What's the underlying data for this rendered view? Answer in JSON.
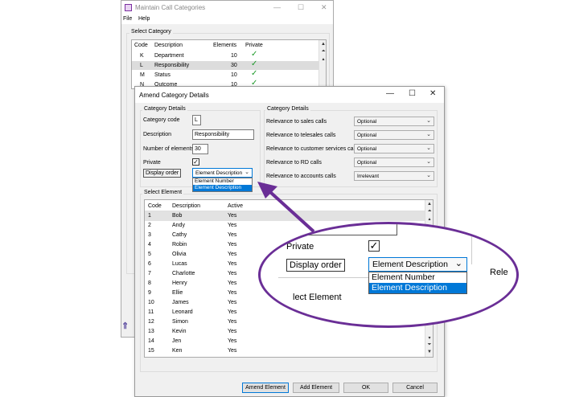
{
  "back_window": {
    "title": "Maintain Call Categories",
    "menu": [
      "File",
      "Help"
    ],
    "group_title": "Select Category",
    "columns": [
      "Code",
      "Description",
      "Elements",
      "Private"
    ],
    "rows": [
      {
        "code": "K",
        "description": "Department",
        "elements": "10",
        "private": "✓"
      },
      {
        "code": "L",
        "description": "Responsibility",
        "elements": "30",
        "private": "✓"
      },
      {
        "code": "M",
        "description": "Status",
        "elements": "10",
        "private": "✓"
      },
      {
        "code": "N",
        "description": "Outcome",
        "elements": "10",
        "private": "✓"
      }
    ],
    "selected_row": 1
  },
  "dialog": {
    "title": "Amend Category Details",
    "left_group": {
      "title": "Category Details",
      "category_code_label": "Category code",
      "category_code": "L",
      "description_label": "Description",
      "description": "Responsibility",
      "elements_label": "Number of elements",
      "elements": "30",
      "private_label": "Private",
      "private_checked": "✓",
      "display_order_label": "Display order",
      "display_order": "Element Description",
      "display_order_options": [
        "Element Number",
        "Element Description"
      ]
    },
    "right_group": {
      "title": "Category Details",
      "rows": [
        {
          "label": "Relevance to sales calls",
          "value": "Optional"
        },
        {
          "label": "Relevance to telesales calls",
          "value": "Optional"
        },
        {
          "label": "Relevance to customer services calls",
          "value": "Optional"
        },
        {
          "label": "Relevance to RD calls",
          "value": "Optional"
        },
        {
          "label": "Relevance to accounts calls",
          "value": "Irrelevant"
        }
      ]
    },
    "elements_group": {
      "title": "Select Element",
      "columns": [
        "Code",
        "Description",
        "Active"
      ],
      "rows": [
        {
          "code": "1",
          "description": "Bob",
          "active": "Yes"
        },
        {
          "code": "2",
          "description": "Andy",
          "active": "Yes"
        },
        {
          "code": "3",
          "description": "Cathy",
          "active": "Yes"
        },
        {
          "code": "4",
          "description": "Robin",
          "active": "Yes"
        },
        {
          "code": "5",
          "description": "Olivia",
          "active": "Yes"
        },
        {
          "code": "6",
          "description": "Lucas",
          "active": "Yes"
        },
        {
          "code": "7",
          "description": "Charlotte",
          "active": "Yes"
        },
        {
          "code": "8",
          "description": "Henry",
          "active": "Yes"
        },
        {
          "code": "9",
          "description": "Ellie",
          "active": "Yes"
        },
        {
          "code": "10",
          "description": "James",
          "active": "Yes"
        },
        {
          "code": "11",
          "description": "Leonard",
          "active": "Yes"
        },
        {
          "code": "12",
          "description": "Simon",
          "active": "Yes"
        },
        {
          "code": "13",
          "description": "Kevin",
          "active": "Yes"
        },
        {
          "code": "14",
          "description": "Jen",
          "active": "Yes"
        },
        {
          "code": "15",
          "description": "Ken",
          "active": "Yes"
        }
      ],
      "selected_row": 0
    },
    "buttons": {
      "amend": "Amend Element",
      "add": "Add Element",
      "ok": "OK",
      "cancel": "Cancel"
    }
  },
  "zoom": {
    "private_label": "Private",
    "private_checked": "✓",
    "display_order_label": "Display order",
    "display_order": "Element Description",
    "options": [
      "Element Number",
      "Element Description"
    ],
    "partial_section_label": "lect Element",
    "partial_right_label": "Rele"
  },
  "colors": {
    "accent": "#0078d7",
    "callout": "#6a2e96",
    "tick": "#1d9a2a"
  }
}
